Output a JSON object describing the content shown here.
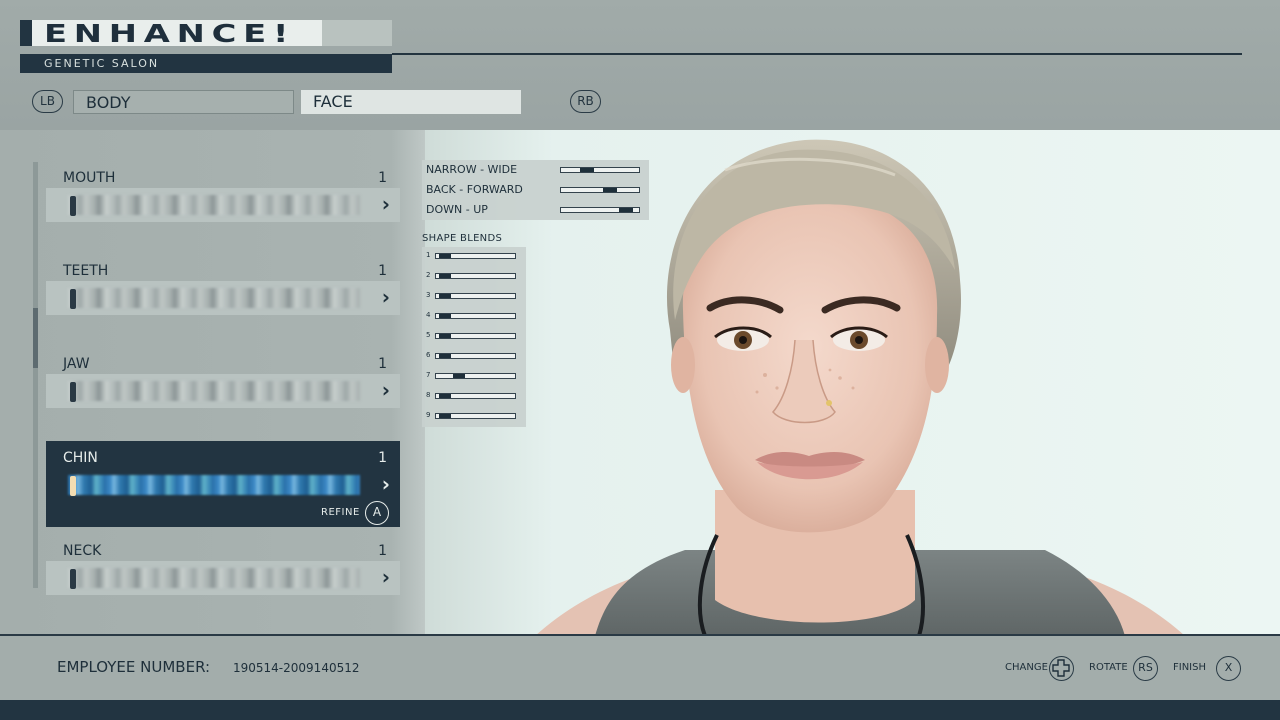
{
  "header": {
    "title": "ENHANCE!",
    "subtitle": "GENETIC SALON",
    "left_bumper": "LB",
    "right_bumper": "RB",
    "tabs": [
      {
        "label": "BODY",
        "active": false
      },
      {
        "label": "FACE",
        "active": true
      }
    ]
  },
  "features": [
    {
      "name": "MOUTH",
      "count": "1",
      "selected": false
    },
    {
      "name": "TEETH",
      "count": "1",
      "selected": false
    },
    {
      "name": "JAW",
      "count": "1",
      "selected": false
    },
    {
      "name": "CHIN",
      "count": "1",
      "selected": true
    },
    {
      "name": "NECK",
      "count": "1",
      "selected": false
    }
  ],
  "refine": {
    "label": "REFINE",
    "button": "A"
  },
  "sliders": [
    {
      "label": "NARROW - WIDE",
      "value": 0.3
    },
    {
      "label": "BACK - FORWARD",
      "value": 0.65
    },
    {
      "label": "DOWN - UP",
      "value": 0.9
    }
  ],
  "shape_blends": {
    "label": "SHAPE BLENDS",
    "items": [
      {
        "num": "1",
        "value": 0.05
      },
      {
        "num": "2",
        "value": 0.05
      },
      {
        "num": "3",
        "value": 0.05
      },
      {
        "num": "4",
        "value": 0.05
      },
      {
        "num": "5",
        "value": 0.05
      },
      {
        "num": "6",
        "value": 0.05
      },
      {
        "num": "7",
        "value": 0.25
      },
      {
        "num": "8",
        "value": 0.05
      },
      {
        "num": "9",
        "value": 0.05
      }
    ]
  },
  "footer": {
    "employee_label": "EMPLOYEE NUMBER:",
    "employee_value": "190514-2009140512",
    "hints": [
      {
        "label": "CHANGE",
        "button_icon": "dpad-icon"
      },
      {
        "label": "ROTATE",
        "button": "RS"
      },
      {
        "label": "FINISH",
        "button": "X"
      }
    ]
  },
  "colors": {
    "accent": "#223441",
    "panel": "#a4aeac",
    "viewport": "#ecf6f3",
    "gene_selected": "#3a87c4"
  }
}
